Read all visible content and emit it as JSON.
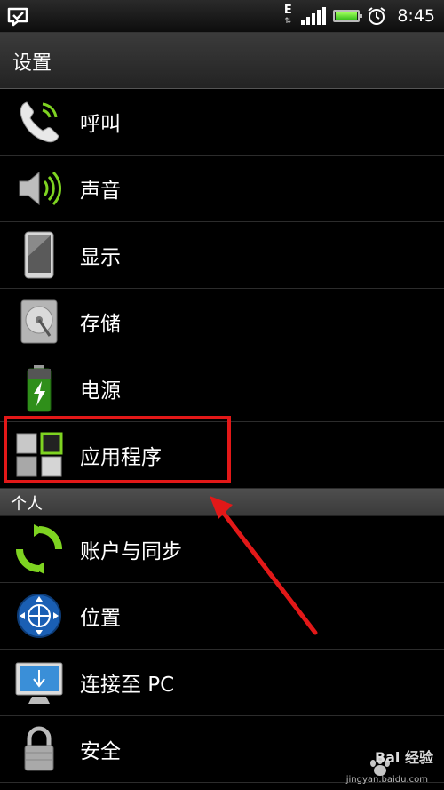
{
  "status_bar": {
    "network": "E",
    "time": "8:45",
    "battery_color": "#5ce82e"
  },
  "header": {
    "title": "设置"
  },
  "items": [
    {
      "label": "呼叫",
      "icon": "phone-icon"
    },
    {
      "label": "声音",
      "icon": "speaker-icon"
    },
    {
      "label": "显示",
      "icon": "display-icon"
    },
    {
      "label": "存储",
      "icon": "storage-icon"
    },
    {
      "label": "电源",
      "icon": "battery-icon"
    },
    {
      "label": "应用程序",
      "icon": "apps-icon"
    }
  ],
  "section_personal": {
    "label": "个人"
  },
  "personal_items": [
    {
      "label": "账户与同步",
      "icon": "sync-icon"
    },
    {
      "label": "位置",
      "icon": "location-icon"
    },
    {
      "label": "连接至 PC",
      "icon": "monitor-icon"
    },
    {
      "label": "安全",
      "icon": "lock-icon"
    }
  ],
  "annotation": {
    "color": "#e21818",
    "target": "应用程序"
  },
  "watermark": {
    "text": "Bai 经验",
    "url": "jingyan.baidu.com"
  }
}
